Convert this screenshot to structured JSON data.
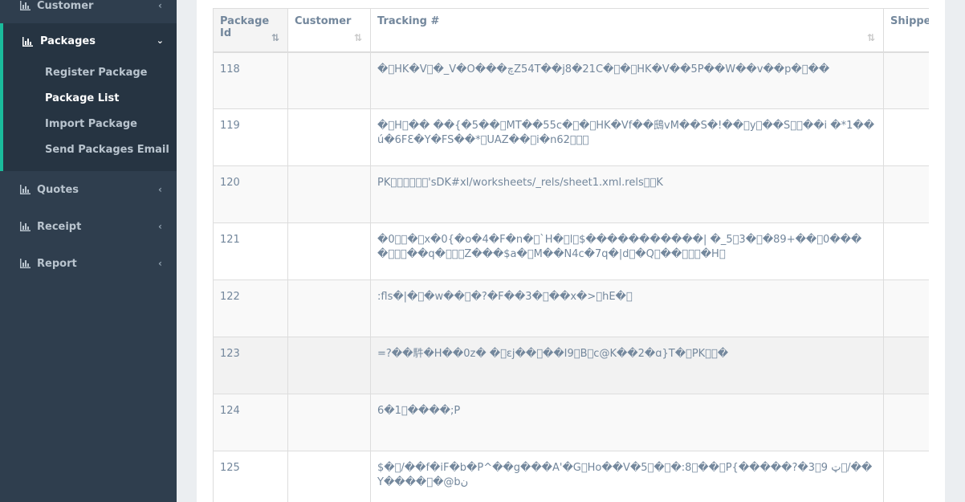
{
  "sidebar": {
    "customer": {
      "label": "Customer"
    },
    "packages": {
      "label": "Packages",
      "items": [
        {
          "label": "Register Package"
        },
        {
          "label": "Package List"
        },
        {
          "label": "Import Package"
        },
        {
          "label": "Send Packages Email"
        }
      ]
    },
    "quotes": {
      "label": "Quotes"
    },
    "receipt": {
      "label": "Receipt"
    },
    "report": {
      "label": "Report"
    }
  },
  "table": {
    "headers": {
      "package_id": "Package Id",
      "customer": "Customer",
      "tracking": "Tracking #",
      "shipper": "Shipper"
    },
    "rows": [
      {
        "id": "118",
        "customer": "",
        "tracking": "�\u0000HK�V\u0000�_V�O���چZ54T��j8�21C�\u0000�\u0000HK�V��5P��W��v��p�\u0000��",
        "shipper": ""
      },
      {
        "id": "119",
        "customer": "",
        "tracking": "�\u0000H\u0000�� ��{�5��\u0000MT��55c�\u0000�\u0000HK�Vf��䲭vM��S�!��\u0000y\u0000��S\u0000\u0000��i �*1��ú�6FƐ�Y�FS��*\u0000UAZ��\u0000i�n62\u0000\u0000\u0000",
        "shipper": ""
      },
      {
        "id": "120",
        "customer": "",
        "tracking": "PK\u0000\u0000\u0000\u0000\u0000\u0000'sDK#xl/worksheets/_rels/sheet1.xml.rels\u0000\u0000K",
        "shipper": ""
      },
      {
        "id": "121",
        "customer": "",
        "tracking": "�0\u0000\u0000�\u0000x�0{�o�4�F�n�\u0000`H�\u0000l\u0000$�����������| �_5\u00003�\u0000�89+��\u00000����\u0000\u0000\u0000��q�\u0000\u0000\u0000Z���$a�\u0000M��N4c�7q�|d\u0000�Q\u0000��\u0000\u0000\u0000�H\u0000",
        "shipper": ""
      },
      {
        "id": "122",
        "customer": "",
        "tracking": ":fls�|�\u0000�w��\u0000�?�F��3�\u0000��x�>\u0000hE�\u0000",
        "shipper": ""
      },
      {
        "id": "123",
        "customer": "",
        "tracking": "=?��䭽�H��0z� �\u0000εj��\u0000��I9\u0000B\u0000c@K��2�ɑ}T�\u0000PK\u0000\u0000�",
        "shipper": ""
      },
      {
        "id": "124",
        "customer": "",
        "tracking": "6�1\u0000����;P",
        "shipper": ""
      },
      {
        "id": "125",
        "customer": "",
        "tracking": "$�\u0000/��f�iF�b�P^��g���A'�G\u0000Ho��V�5\u0000�\u0000�:8\u0000��\u0000P{�����?�ټ 3\u00009\u0000/��Y����\u0000�@bن",
        "shipper": ""
      }
    ]
  }
}
